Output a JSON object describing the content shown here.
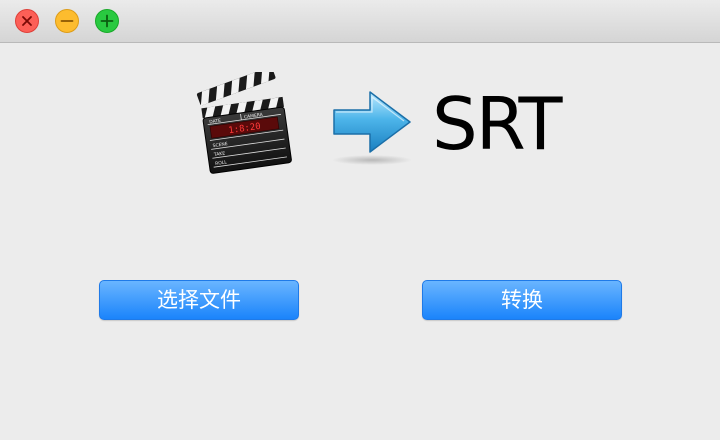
{
  "window": {
    "controls": {
      "close_icon": "close-icon",
      "minimize_icon": "minimize-icon",
      "zoom_icon": "zoom-icon"
    }
  },
  "main": {
    "source_icon": "clapperboard-icon",
    "clapper_text": {
      "date": "DATE",
      "camera": "CAMERA",
      "timecode": "1:8:20",
      "scene": "SCENE",
      "take": "TAKE",
      "roll": "ROLL"
    },
    "arrow_icon": "right-arrow-icon",
    "target_format": "SRT"
  },
  "buttons": {
    "choose_file_label": "选择文件",
    "convert_label": "转换"
  },
  "colors": {
    "close": "#fc5f57",
    "minimize": "#fdbc2e",
    "zoom": "#29c940",
    "button_blue": "#1b84fb",
    "arrow_blue": "#2a9bd8"
  }
}
